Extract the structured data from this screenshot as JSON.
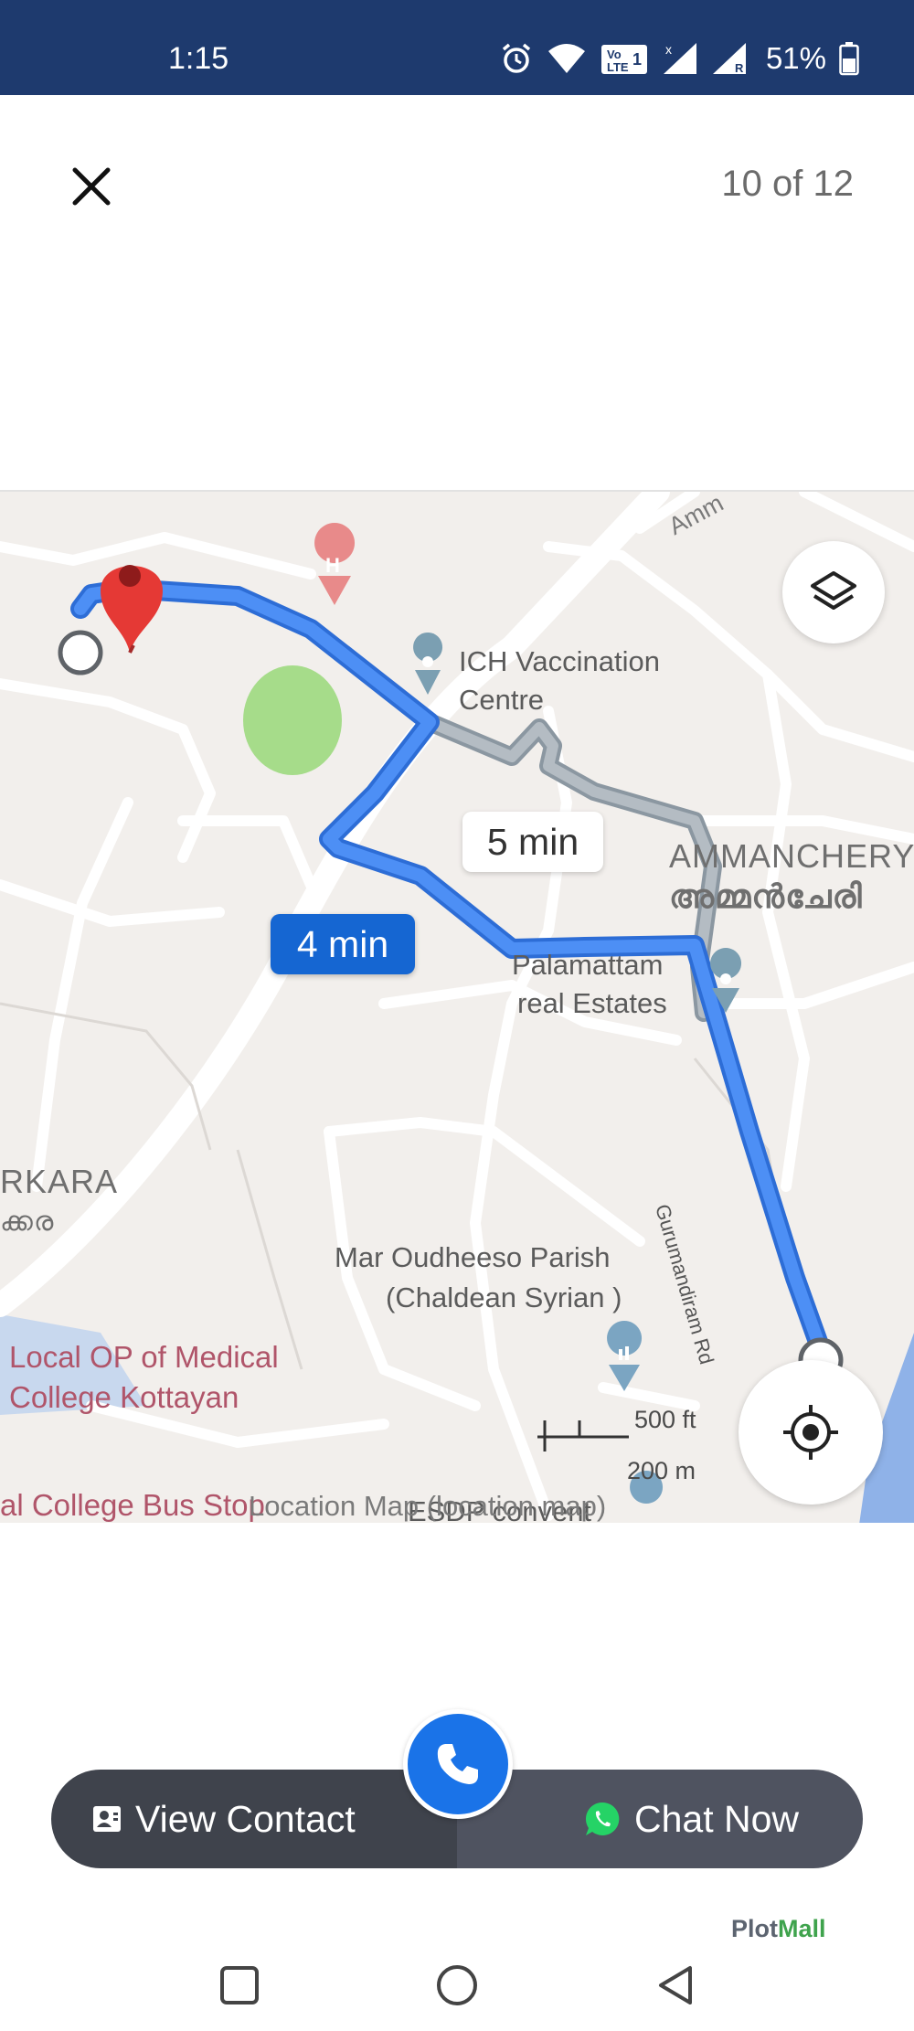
{
  "status_bar": {
    "time": "1:15",
    "battery": "51%",
    "icons": [
      "alarm-icon",
      "wifi-icon",
      "volte-icon",
      "signal-icon",
      "signal-roaming-icon",
      "battery-icon"
    ]
  },
  "header": {
    "close_icon": "close-icon",
    "counter": "10 of 12"
  },
  "map": {
    "route_times": {
      "alternate": "5 min",
      "primary": "4 min"
    },
    "places": {
      "ich_line1": "ICH Vaccination",
      "ich_line2": "Centre",
      "ammanchery": "AMMANCHERY",
      "ammanchery_ml": "അമ്മൻചേരി",
      "palamattam_line1": "Palamattam",
      "palamattam_line2": "real Estates",
      "rkara": "RKARA",
      "rkara_ml": "ക്കര",
      "mar_line1": "Mar Oudheeso Parish",
      "mar_line2": "(Chaldean Syrian )",
      "local_op_line1": "Local OP of Medical",
      "local_op_line2": "College Kottayan",
      "bus_stop": "al College Bus Stop",
      "esdp": "ESDP convent",
      "road": "Gurumandiram Rd",
      "amm_top": "Amm"
    },
    "scale": {
      "feet": "500 ft",
      "meters": "200 m"
    },
    "caption": "Location Map (location map)",
    "colors": {
      "route_primary": "#4285f4",
      "route_alternate": "#9aa4ad",
      "pin": "#e53935"
    }
  },
  "actions": {
    "view_contact": "View Contact",
    "chat_now": "Chat Now",
    "call_icon": "phone-icon"
  },
  "brand": {
    "part1": "Plot",
    "part2": "Mall"
  },
  "nav": [
    "recents-button",
    "home-button",
    "back-button"
  ]
}
